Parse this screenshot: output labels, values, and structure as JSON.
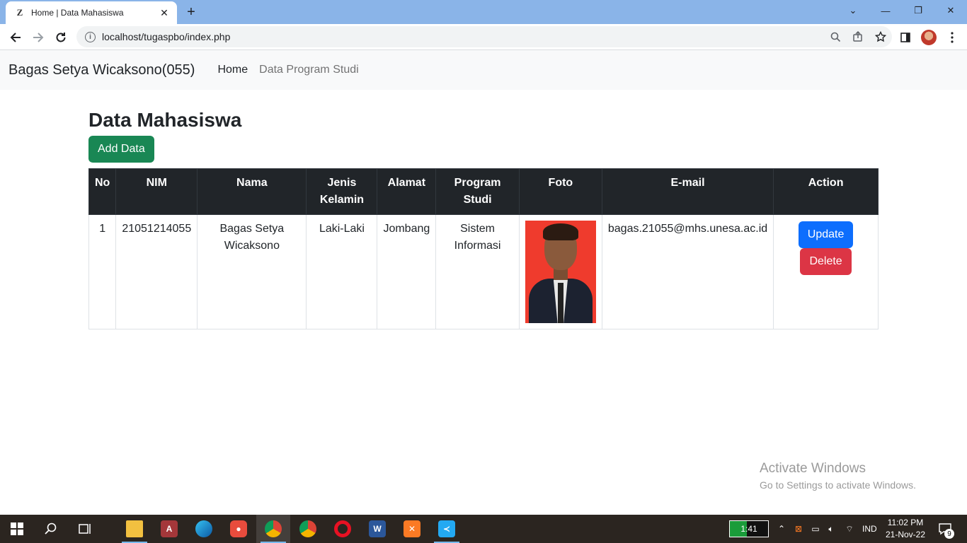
{
  "browser": {
    "tab_favicon": "Z",
    "tab_title": "Home | Data Mahasiswa",
    "tab_close": "✕",
    "new_tab": "+",
    "url": "localhost/tugaspbo/index.php",
    "window_controls": {
      "minimize": "—",
      "restore": "❐",
      "close": "✕",
      "tabsearch": "⌄"
    }
  },
  "navbar": {
    "brand": "Bagas Setya Wicaksono(055)",
    "links": [
      {
        "label": "Home",
        "active": true
      },
      {
        "label": "Data Program Studi",
        "active": false
      }
    ]
  },
  "main": {
    "title": "Data Mahasiswa",
    "add_button": "Add Data",
    "table": {
      "headers": [
        "No",
        "NIM",
        "Nama",
        "Jenis Kelamin",
        "Alamat",
        "Program Studi",
        "Foto",
        "E-mail",
        "Action"
      ],
      "rows": [
        {
          "no": "1",
          "nim": "21051214055",
          "nama": "Bagas Setya Wicaksono",
          "jenis_kelamin": "Laki-Laki",
          "alamat": "Jombang",
          "program_studi": "Sistem Informasi",
          "email": "bagas.21055@mhs.unesa.ac.id",
          "update_label": "Update",
          "delete_label": "Delete"
        }
      ]
    }
  },
  "watermark": {
    "line1": "Activate Windows",
    "line2": "Go to Settings to activate Windows."
  },
  "taskbar": {
    "battery_time": "1:41",
    "language": "IND",
    "time": "11:02 PM",
    "date": "21-Nov-22",
    "notifications": "9"
  },
  "colors": {
    "primary": "#0d6efd",
    "success": "#198754",
    "danger": "#dc3545",
    "table_head": "#212529",
    "tabstrip": "#8ab4e8"
  }
}
